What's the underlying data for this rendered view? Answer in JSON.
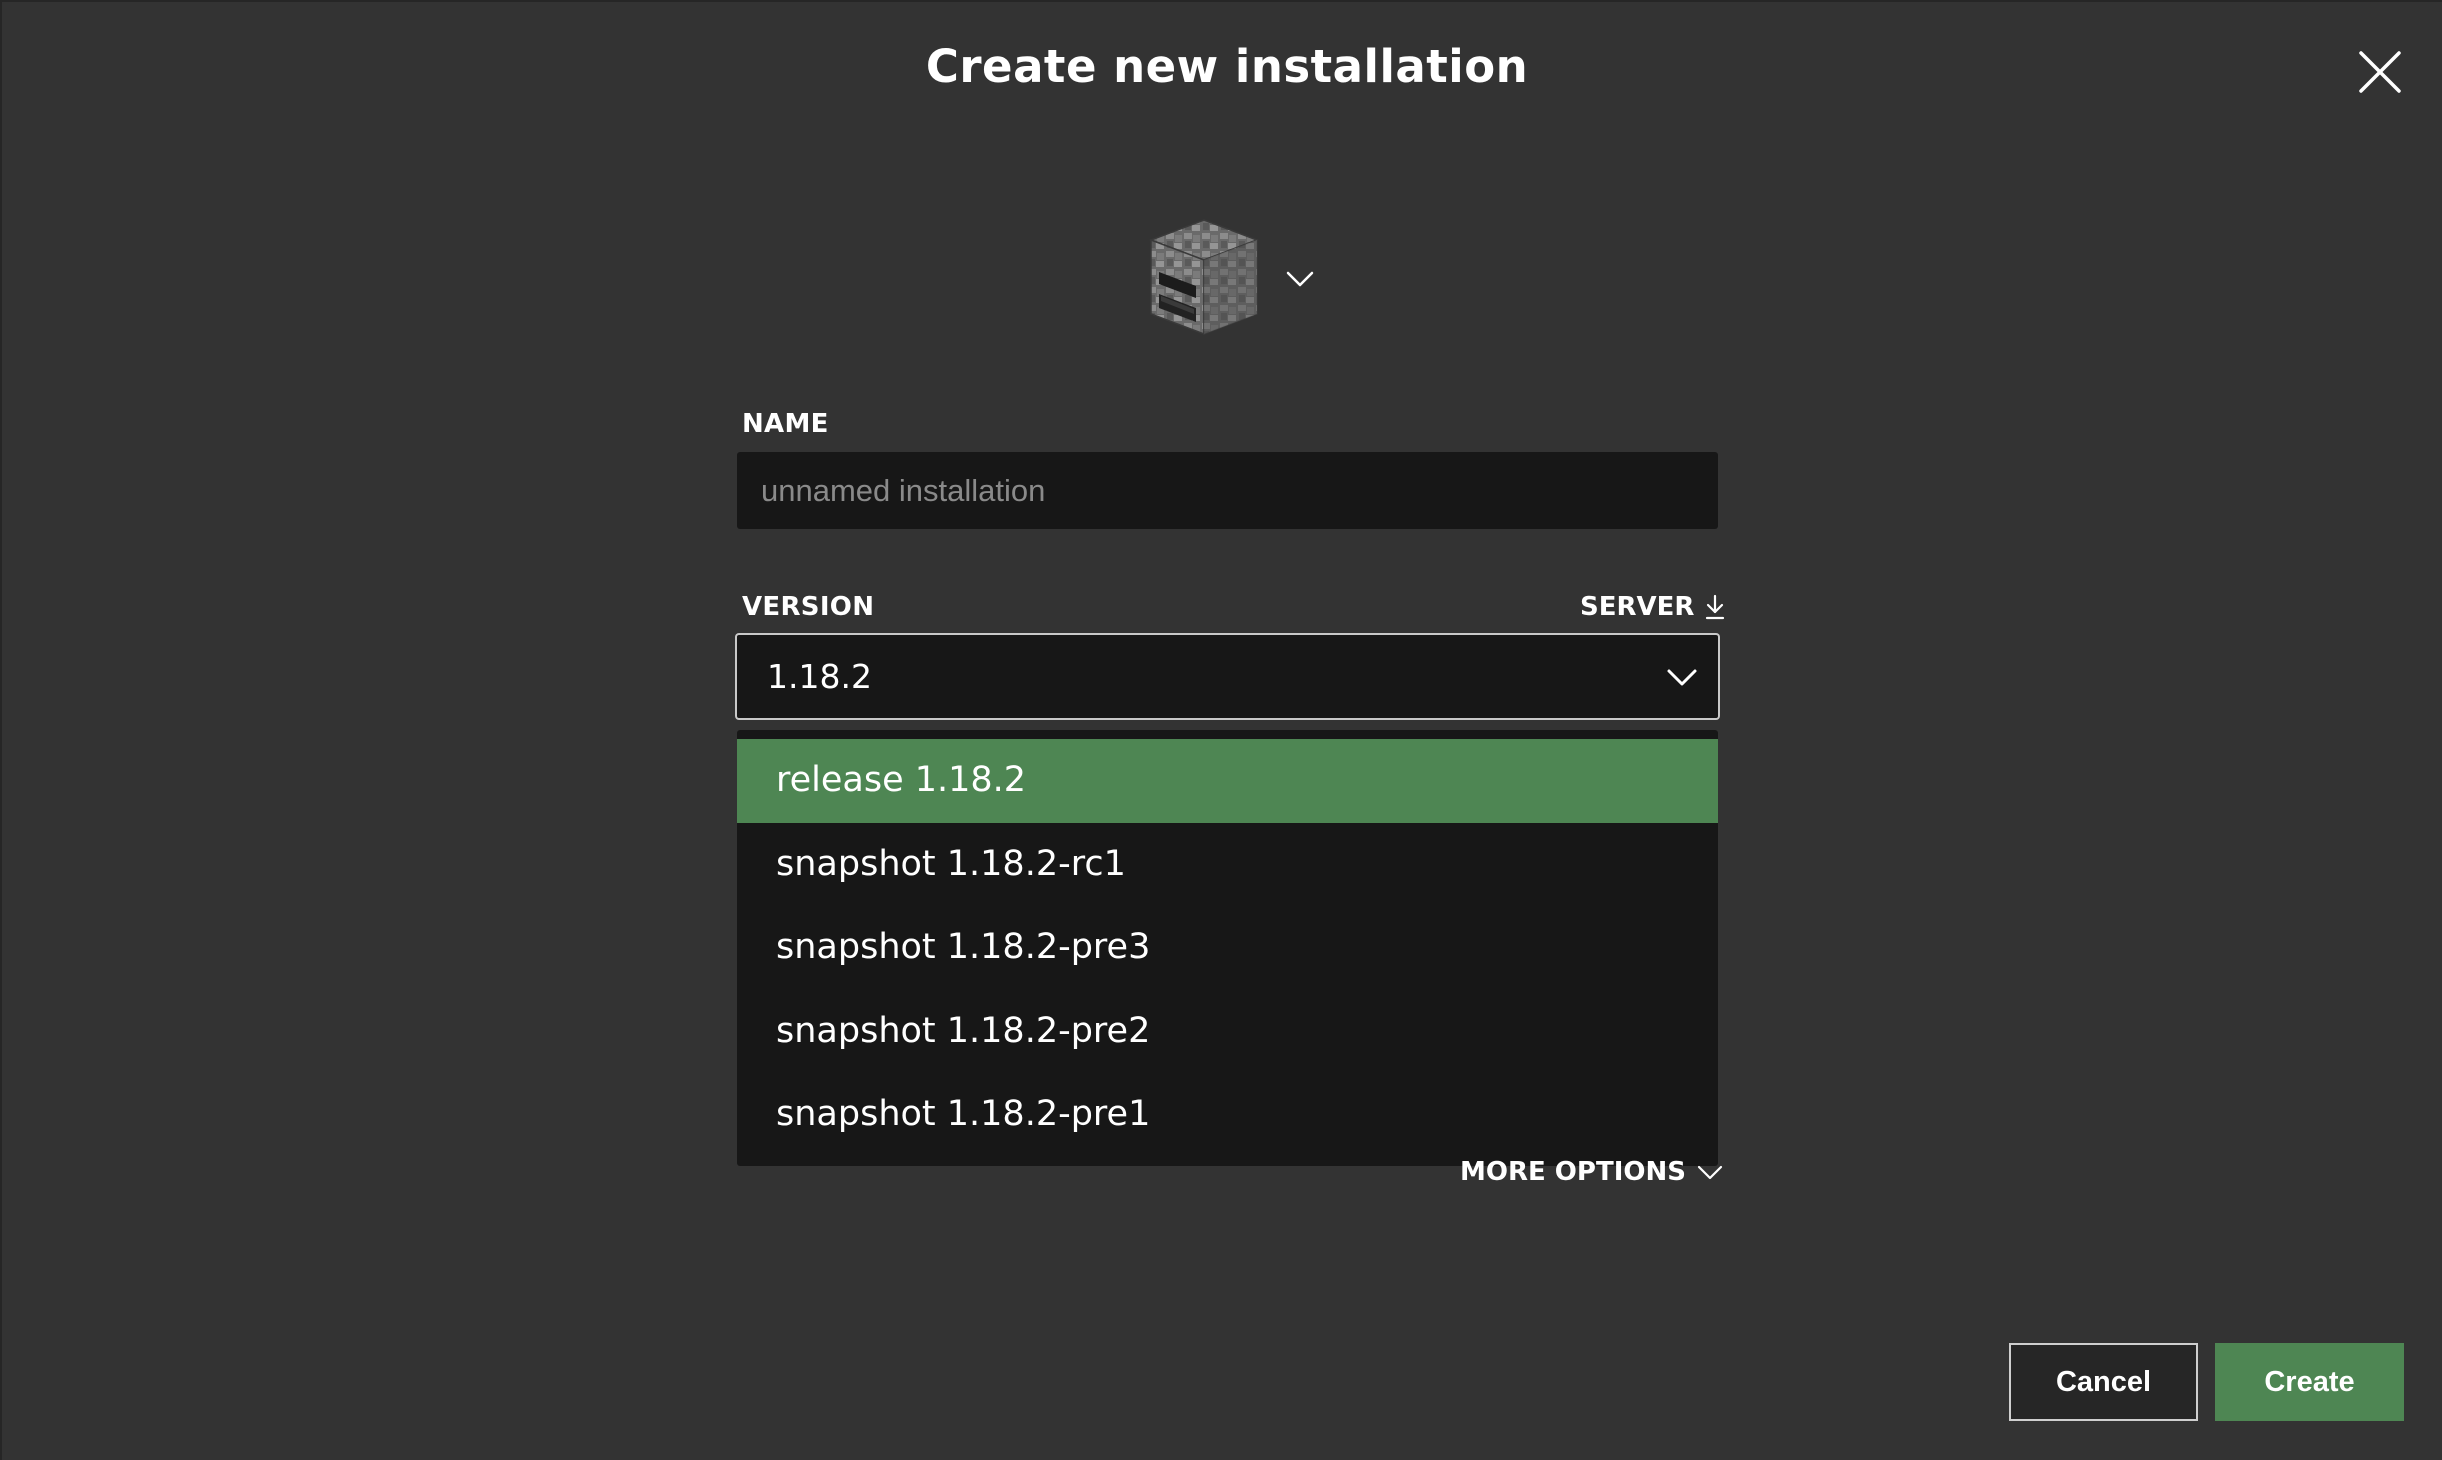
{
  "dialog": {
    "title": "Create new installation"
  },
  "icon_picker": {
    "icon": "furnace-icon",
    "dropdown_icon": "chevron-down-icon"
  },
  "name_field": {
    "label": "NAME",
    "value": "",
    "placeholder": "unnamed installation"
  },
  "version_field": {
    "label": "VERSION",
    "server_link": "SERVER",
    "server_icon": "download-icon",
    "selected_value": "1.18.2",
    "options": [
      "release 1.18.2",
      "snapshot 1.18.2-rc1",
      "snapshot 1.18.2-pre3",
      "snapshot 1.18.2-pre2",
      "snapshot 1.18.2-pre1"
    ],
    "highlighted_option": "release 1.18.2"
  },
  "more_options": "MORE OPTIONS",
  "buttons": {
    "cancel": "Cancel",
    "create": "Create"
  },
  "colors": {
    "background": "#333333",
    "input_background": "#171717",
    "accent_green": "#4e8653",
    "text": "#ffffff"
  }
}
